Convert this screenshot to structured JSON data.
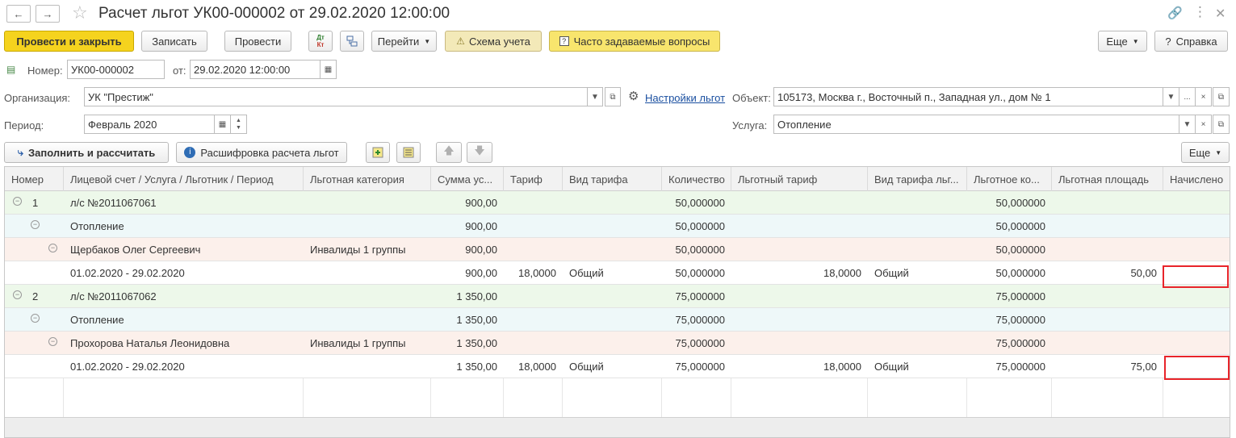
{
  "window": {
    "title": "Расчет льгот УК00-000002 от 29.02.2020 12:00:00",
    "nav_back_icon": "arrow-left",
    "nav_forward_icon": "arrow-right",
    "star_icon": "star"
  },
  "toolbar": {
    "post_close": "Провести и закрыть",
    "save": "Записать",
    "post": "Провести",
    "goto": "Перейти",
    "scheme": "Схема учета",
    "faq": "Часто задаваемые вопросы",
    "more": "Еще",
    "help": "Справка",
    "dtkt_top": "Дт",
    "dtkt_bottom": "Кт"
  },
  "form": {
    "number_label": "Номер:",
    "number_value": "УК00-000002",
    "date_label": "от:",
    "date_value": "29.02.2020 12:00:00",
    "org_label": "Организация:",
    "org_value": "УК \"Престиж\"",
    "settings_link": "Настройки льгот",
    "object_label": "Объект:",
    "object_value": "105173, Москва г., Восточный п., Западная ул., дом № 1",
    "period_label": "Период:",
    "period_value": "Февраль 2020",
    "service_label": "Услуга:",
    "service_value": "Отопление",
    "more_dots": "...",
    "clear_x": "×"
  },
  "table_toolbar": {
    "fill_calc": "Заполнить и рассчитать",
    "decode": "Расшифровка расчета льгот",
    "more": "Еще"
  },
  "table": {
    "headers": [
      "Номер",
      "Лицевой счет / Услуга / Льготник / Период",
      "Льготная категория",
      "Сумма ус...",
      "Тариф",
      "Вид тарифа",
      "Количество",
      "Льготный тариф",
      "Вид тарифа льг...",
      "Льготное ко...",
      "Льготная площадь",
      "Начислено"
    ],
    "rows": [
      {
        "num": "1",
        "name": "л/с №2011067061",
        "cat": "",
        "sum": "900,00",
        "tariff": "",
        "tariff_type": "",
        "qty": "50,000000",
        "ben_tariff": "",
        "ben_tariff_type": "",
        "ben_qty": "50,000000",
        "area": "",
        "charged": ""
      },
      {
        "num": "",
        "name": "Отопление",
        "cat": "",
        "sum": "900,00",
        "tariff": "",
        "tariff_type": "",
        "qty": "50,000000",
        "ben_tariff": "",
        "ben_tariff_type": "",
        "ben_qty": "50,000000",
        "area": "",
        "charged": ""
      },
      {
        "num": "",
        "name": "Щербаков Олег Сергеевич",
        "cat": "Инвалиды 1 группы",
        "sum": "900,00",
        "tariff": "",
        "tariff_type": "",
        "qty": "50,000000",
        "ben_tariff": "",
        "ben_tariff_type": "",
        "ben_qty": "50,000000",
        "area": "",
        "charged": ""
      },
      {
        "num": "",
        "name": "01.02.2020 - 29.02.2020",
        "cat": "",
        "sum": "900,00",
        "tariff": "18,0000",
        "tariff_type": "Общий",
        "qty": "50,000000",
        "ben_tariff": "18,0000",
        "ben_tariff_type": "Общий",
        "ben_qty": "50,000000",
        "area": "50,00",
        "charged": ""
      },
      {
        "num": "2",
        "name": "л/с №2011067062",
        "cat": "",
        "sum": "1 350,00",
        "tariff": "",
        "tariff_type": "",
        "qty": "75,000000",
        "ben_tariff": "",
        "ben_tariff_type": "",
        "ben_qty": "75,000000",
        "area": "",
        "charged": ""
      },
      {
        "num": "",
        "name": "Отопление",
        "cat": "",
        "sum": "1 350,00",
        "tariff": "",
        "tariff_type": "",
        "qty": "75,000000",
        "ben_tariff": "",
        "ben_tariff_type": "",
        "ben_qty": "75,000000",
        "area": "",
        "charged": ""
      },
      {
        "num": "",
        "name": "Прохорова Наталья Леонидовна",
        "cat": "Инвалиды 1 группы",
        "sum": "1 350,00",
        "tariff": "",
        "tariff_type": "",
        "qty": "75,000000",
        "ben_tariff": "",
        "ben_tariff_type": "",
        "ben_qty": "75,000000",
        "area": "",
        "charged": ""
      },
      {
        "num": "",
        "name": "01.02.2020 - 29.02.2020",
        "cat": "",
        "sum": "1 350,00",
        "tariff": "18,0000",
        "tariff_type": "Общий",
        "qty": "75,000000",
        "ben_tariff": "18,0000",
        "ben_tariff_type": "Общий",
        "ben_qty": "75,000000",
        "area": "75,00",
        "charged": ""
      }
    ]
  },
  "colors": {
    "primary_button": "#f5d31e",
    "level1_row": "#edf8ea",
    "level2_row": "#eef8f9",
    "level3_row": "#fcf0eb",
    "highlight_border": "#e8242a",
    "link": "#1a4fa0"
  }
}
